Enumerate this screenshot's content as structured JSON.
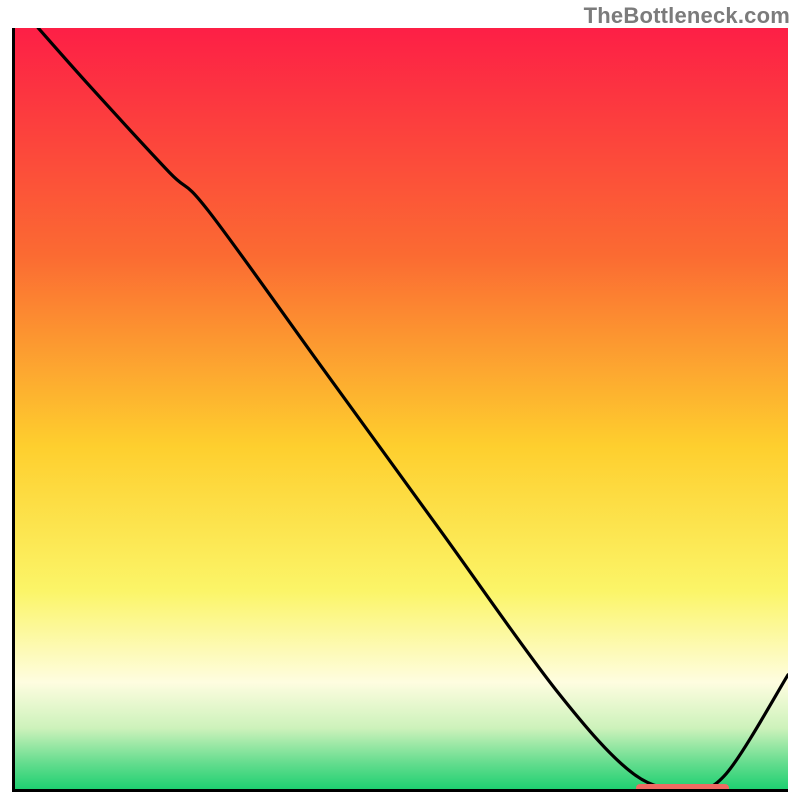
{
  "watermark": "TheBottleneck.com",
  "colors": {
    "gradient_top": "#fd1f46",
    "gradient_mid1": "#fb8b2c",
    "gradient_mid2": "#fde531",
    "gradient_lower": "#fdfbc2",
    "gradient_green_top": "#b9eea2",
    "gradient_green_bottom": "#23d473",
    "curve": "#000000",
    "marker": "#ef6a62"
  },
  "chart_data": {
    "type": "line",
    "title": "",
    "xlabel": "",
    "ylabel": "",
    "xlim": [
      0,
      100
    ],
    "ylim": [
      0,
      100
    ],
    "gradient_stops": [
      {
        "offset": 0.0,
        "color": "#fd1f46"
      },
      {
        "offset": 0.3,
        "color": "#fb6b32"
      },
      {
        "offset": 0.55,
        "color": "#fecf2e"
      },
      {
        "offset": 0.74,
        "color": "#fbf568"
      },
      {
        "offset": 0.86,
        "color": "#fefde0"
      },
      {
        "offset": 0.92,
        "color": "#cdf2bb"
      },
      {
        "offset": 0.965,
        "color": "#66dd8f"
      },
      {
        "offset": 1.0,
        "color": "#1fd071"
      }
    ],
    "series": [
      {
        "name": "bottleneck-curve",
        "x": [
          3,
          10,
          20,
          25,
          40,
          55,
          70,
          80,
          87,
          92,
          100
        ],
        "y": [
          100,
          92,
          81,
          76,
          55,
          34,
          13,
          2,
          0,
          2,
          15
        ]
      }
    ],
    "marker_band": {
      "x_start": 80,
      "x_end": 92,
      "y": 0.5
    }
  }
}
